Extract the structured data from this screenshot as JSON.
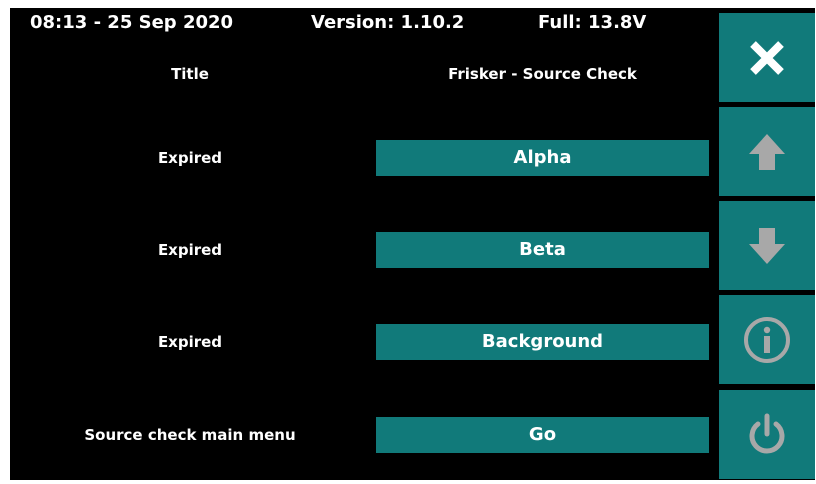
{
  "status_bar": {
    "datetime": "08:13 - 25 Sep 2020",
    "version": "Version: 1.10.2",
    "battery": "Full:  13.8V"
  },
  "header": {
    "label": "Title",
    "value": "Frisker - Source Check"
  },
  "rows": [
    {
      "label": "Expired",
      "button": "Alpha"
    },
    {
      "label": "Expired",
      "button": "Beta"
    },
    {
      "label": "Expired",
      "button": "Background"
    },
    {
      "label": "Source check main menu",
      "button": "Go"
    }
  ],
  "side_buttons": [
    {
      "icon": "close-icon"
    },
    {
      "icon": "arrow-up-icon"
    },
    {
      "icon": "arrow-down-icon"
    },
    {
      "icon": "info-icon"
    },
    {
      "icon": "power-icon"
    }
  ],
  "colors": {
    "background": "#000000",
    "button": "#117a7a",
    "text": "#ffffff",
    "icon_active": "#ffffff",
    "icon_disabled": "#a8a8a8"
  }
}
